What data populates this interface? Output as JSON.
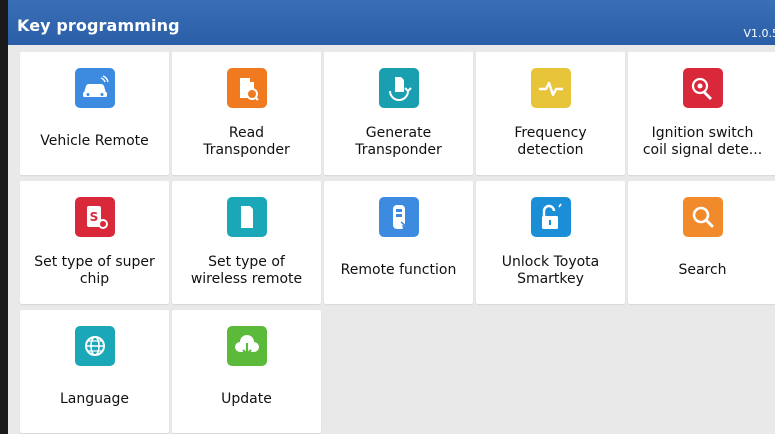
{
  "header": {
    "title": "Key programming",
    "version": "V1.0.5"
  },
  "tiles": [
    {
      "label": "Vehicle Remote",
      "icon": "car-remote-icon",
      "color": "#3c8be0"
    },
    {
      "label": "Read\nTransponder",
      "icon": "read-transponder-icon",
      "color": "#ef7a20"
    },
    {
      "label": "Generate\nTransponder",
      "icon": "generate-transponder-icon",
      "color": "#1a9fb0"
    },
    {
      "label": "Frequency\ndetection",
      "icon": "frequency-wave-icon",
      "color": "#e8c43a"
    },
    {
      "label": "Ignition switch\ncoil signal dete...",
      "icon": "ignition-key-icon",
      "color": "#d8283a"
    },
    {
      "label": "Set type of super\nchip",
      "icon": "super-chip-icon",
      "color": "#d8283a"
    },
    {
      "label": "Set type of\nwireless remote",
      "icon": "wireless-remote-chip-icon",
      "color": "#1aa7b8"
    },
    {
      "label": "Remote function",
      "icon": "remote-key-icon",
      "color": "#3c8be0"
    },
    {
      "label": "Unlock Toyota\nSmartkey",
      "icon": "unlock-padlock-icon",
      "color": "#1a8fd8"
    },
    {
      "label": "Search",
      "icon": "search-icon",
      "color": "#f08a2a"
    },
    {
      "label": "Language",
      "icon": "globe-icon",
      "color": "#1aa7b8"
    },
    {
      "label": "Update",
      "icon": "cloud-download-icon",
      "color": "#5cba3a"
    }
  ]
}
